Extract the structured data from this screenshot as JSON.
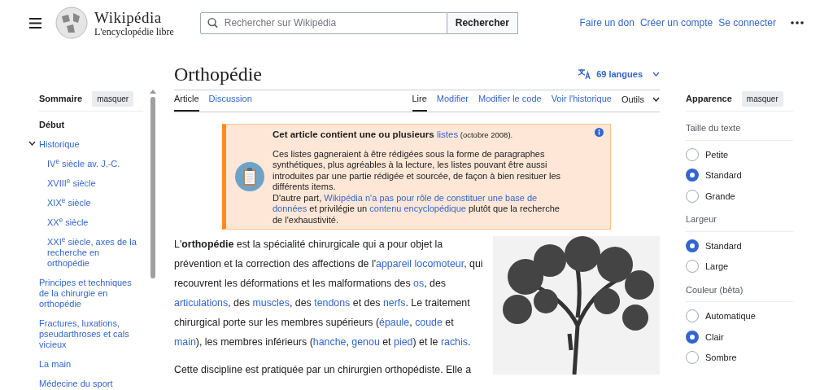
{
  "header": {
    "logo_title": "Wikipédia",
    "logo_subtitle": "L'encyclopédie libre",
    "search": {
      "placeholder": "Rechercher sur Wikipédia"
    },
    "search_button": "Rechercher",
    "links": [
      "Faire un don",
      "Créer un compte",
      "Se connecter"
    ]
  },
  "toc": {
    "title": "Sommaire",
    "hide_button": "masquer",
    "items": [
      {
        "label": "Début",
        "selected": true,
        "expanded": false
      },
      {
        "label": "Historique",
        "selected": false,
        "expanded": true,
        "children": [
          {
            "label": "IV$^{e}$ siècle av. J.-C."
          },
          {
            "label": "XVIII$^{e}$ siècle"
          },
          {
            "label": "XIX$^{e}$ siècle"
          },
          {
            "label": "XX$^{e}$ siècle"
          },
          {
            "label": "XXI$^{e}$ siècle, axes de la recherche en orthopédie"
          }
        ]
      },
      {
        "label": "Principes et techniques de la chirurgie en orthopédie",
        "selected": false,
        "expanded": false
      },
      {
        "label": "Fractures, luxations, pseudarthroses et cals vicieux",
        "selected": false,
        "expanded": false
      },
      {
        "label": "La main",
        "selected": false,
        "expanded": false
      },
      {
        "label": "Médecine du sport",
        "selected": false,
        "expanded": false
      }
    ]
  },
  "article": {
    "title": "Orthopédie",
    "languages": "69 langues",
    "tabs_left": [
      {
        "label": "Article",
        "selected": true
      },
      {
        "label": "Discussion",
        "selected": false
      }
    ],
    "tabs_right": [
      {
        "label": "Lire",
        "selected": true
      },
      {
        "label": "Modifier",
        "selected": false
      },
      {
        "label": "Modifier le code",
        "selected": false
      },
      {
        "label": "Voir l'historique",
        "selected": false
      }
    ],
    "tools": "Outils",
    "banner": {
      "title": [
        {
          "kind": "bold",
          "text": "Cet article contient une ou plusieurs "
        },
        {
          "kind": "link",
          "text": "listes"
        },
        {
          "kind": "small",
          "text": " (octobre 2008)."
        }
      ],
      "body": [
        {
          "kind": "text",
          "text": "Ces listes gagneraient à être rédigées sous la forme de paragraphes synthétiques, plus agréables à la lecture, les listes pouvant être aussi introduites par une partie rédigée et sourcée, de façon à bien resituer les différents items."
        }
      ],
      "body2": [
        {
          "kind": "text",
          "text": "D'autre part, "
        },
        {
          "kind": "link",
          "text": "Wikipédia n'a pas pour rôle de constituer une base de"
        },
        {
          "kind": "link",
          "text": "données"
        },
        {
          "kind": "text",
          "text": " et privilégie un "
        },
        {
          "kind": "link",
          "text": "contenu encyclopédique"
        },
        {
          "kind": "text",
          "text": " plutôt que la recherche de l'exhaustivité."
        }
      ]
    },
    "paragraphs": [
      [
        {
          "kind": "text",
          "text": "L'"
        },
        {
          "kind": "bold",
          "text": "orthopédie"
        },
        {
          "kind": "text",
          "text": " est la spécialité chirurgicale qui a pour objet la prévention et la correction des affections de l'"
        },
        {
          "kind": "link",
          "text": "appareil locomoteur"
        },
        {
          "kind": "text",
          "text": ", qui recouvrent les déformations et les malformations des "
        },
        {
          "kind": "link",
          "text": "os"
        },
        {
          "kind": "text",
          "text": ", des "
        },
        {
          "kind": "link",
          "text": "articulations"
        },
        {
          "kind": "text",
          "text": ", des "
        },
        {
          "kind": "link",
          "text": "muscles"
        },
        {
          "kind": "text",
          "text": ", des "
        },
        {
          "kind": "link",
          "text": "tendons"
        },
        {
          "kind": "text",
          "text": " et des "
        },
        {
          "kind": "link",
          "text": "nerfs"
        },
        {
          "kind": "text",
          "text": ". Le traitement chirurgical porte sur les membres supérieurs ("
        },
        {
          "kind": "link",
          "text": "épaule"
        },
        {
          "kind": "text",
          "text": ", "
        },
        {
          "kind": "link",
          "text": "coude"
        },
        {
          "kind": "text",
          "text": " et "
        },
        {
          "kind": "link",
          "text": "main"
        },
        {
          "kind": "text",
          "text": "), les membres inférieurs ("
        },
        {
          "kind": "link",
          "text": "hanche"
        },
        {
          "kind": "text",
          "text": ", "
        },
        {
          "kind": "link",
          "text": "genou"
        },
        {
          "kind": "text",
          "text": " et "
        },
        {
          "kind": "link",
          "text": "pied"
        },
        {
          "kind": "text",
          "text": ") et le "
        },
        {
          "kind": "link",
          "text": "rachis"
        },
        {
          "kind": "text",
          "text": "."
        }
      ],
      [
        {
          "kind": "text",
          "text": "Cette discipline est pratiquée par un chirurgien orthopédiste. Elle a"
        }
      ]
    ]
  },
  "appearance": {
    "title": "Apparence",
    "hide_button": "masquer",
    "groups": [
      {
        "label": "Taille du texte",
        "options": [
          {
            "label": "Petite",
            "selected": false
          },
          {
            "label": "Standard",
            "selected": true
          },
          {
            "label": "Grande",
            "selected": false
          }
        ]
      },
      {
        "label": "Largeur",
        "options": [
          {
            "label": "Standard",
            "selected": true
          },
          {
            "label": "Large",
            "selected": false
          }
        ]
      },
      {
        "label": "Couleur (bêta)",
        "options": [
          {
            "label": "Automatique",
            "selected": false
          },
          {
            "label": "Clair",
            "selected": true
          },
          {
            "label": "Sombre",
            "selected": false
          }
        ]
      }
    ]
  }
}
